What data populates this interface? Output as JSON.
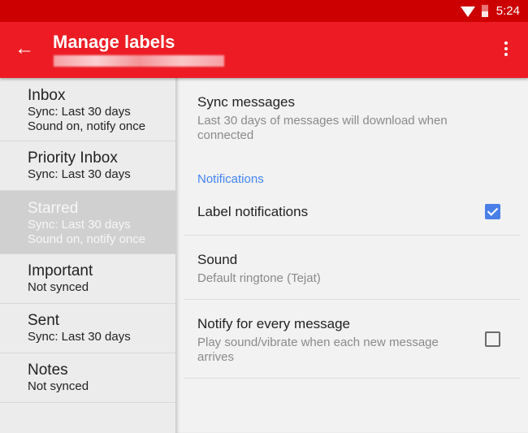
{
  "status": {
    "time": "5:24"
  },
  "toolbar": {
    "title": "Manage labels",
    "back_icon": "←"
  },
  "labels": [
    {
      "name": "Inbox",
      "lines": [
        "Sync: Last 30 days",
        "Sound on, notify once"
      ]
    },
    {
      "name": "Priority Inbox",
      "lines": [
        "Sync: Last 30 days"
      ]
    },
    {
      "name": "Starred",
      "lines": [
        "Sync: Last 30 days",
        "Sound on, notify once"
      ]
    },
    {
      "name": "Important",
      "lines": [
        "Not synced"
      ]
    },
    {
      "name": "Sent",
      "lines": [
        "Sync: Last 30 days"
      ]
    },
    {
      "name": "Notes",
      "lines": [
        "Not synced"
      ]
    }
  ],
  "settings": {
    "sync": {
      "title": "Sync messages",
      "sub": "Last 30 days of messages will download when connected"
    },
    "section": "Notifications",
    "label_notif": {
      "title": "Label notifications",
      "checked": true
    },
    "sound": {
      "title": "Sound",
      "sub": "Default ringtone (Tejat)"
    },
    "every": {
      "title": "Notify for every message",
      "sub": "Play sound/vibrate when each new message arrives",
      "checked": false
    }
  },
  "colors": {
    "toolbar": "#ed1c24",
    "status": "#cc0000",
    "accent": "#4285f4"
  }
}
